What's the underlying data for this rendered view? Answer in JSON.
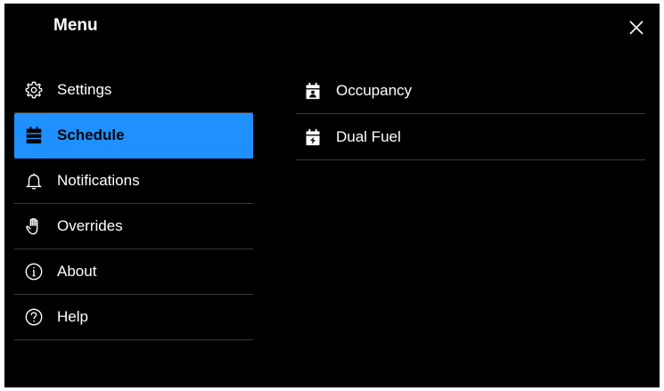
{
  "header": {
    "title": "Menu",
    "close_icon": "close-icon"
  },
  "sidebar": {
    "items": [
      {
        "label": "Settings",
        "icon": "gear-icon",
        "active": false
      },
      {
        "label": "Schedule",
        "icon": "calendar-icon",
        "active": true
      },
      {
        "label": "Notifications",
        "icon": "bell-icon",
        "active": false
      },
      {
        "label": "Overrides",
        "icon": "hand-icon",
        "active": false
      },
      {
        "label": "About",
        "icon": "info-icon",
        "active": false
      },
      {
        "label": "Help",
        "icon": "question-icon",
        "active": false
      }
    ]
  },
  "submenu": {
    "items": [
      {
        "label": "Occupancy",
        "icon": "calendar-person-icon"
      },
      {
        "label": "Dual Fuel",
        "icon": "calendar-bolt-icon"
      }
    ]
  },
  "colors": {
    "accent": "#1e90ff",
    "background": "#000000",
    "divider": "#3a3a3a",
    "text": "#ffffff"
  }
}
